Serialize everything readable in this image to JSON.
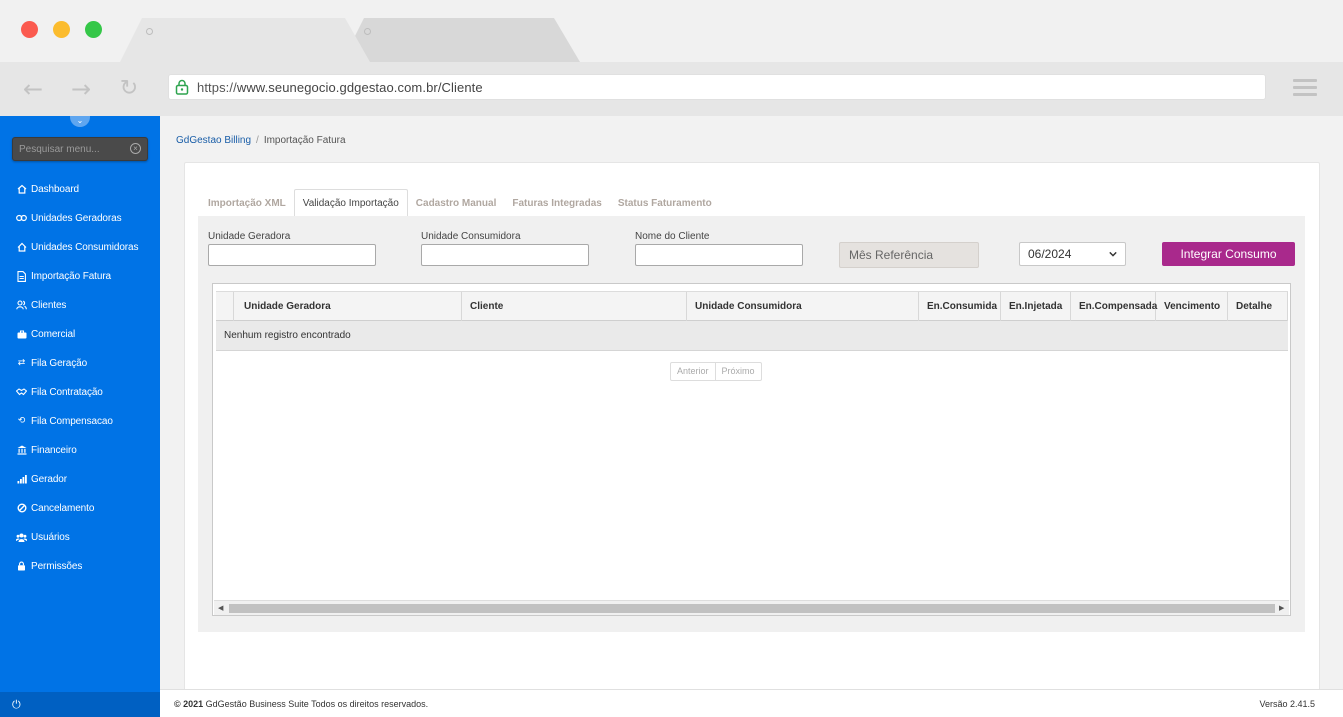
{
  "browser": {
    "url_scheme": "https://",
    "url_host": "www.seunegocio.gdgestao.com.br/Cliente"
  },
  "sidebar": {
    "search_placeholder": "Pesquisar menu...",
    "items": [
      {
        "label": "Dashboard",
        "icon": "home-icon"
      },
      {
        "label": "Unidades Geradoras",
        "icon": "link-icon"
      },
      {
        "label": "Unidades Consumidoras",
        "icon": "house-icon"
      },
      {
        "label": "Importação Fatura",
        "icon": "file-icon"
      },
      {
        "label": "Clientes",
        "icon": "users-icon"
      },
      {
        "label": "Comercial",
        "icon": "briefcase-icon"
      },
      {
        "label": "Fila Geração",
        "icon": "exchange-icon"
      },
      {
        "label": "Fila Contratação",
        "icon": "handshake-icon"
      },
      {
        "label": "Fila Compensacao",
        "icon": "refresh-icon"
      },
      {
        "label": "Financeiro",
        "icon": "bank-icon"
      },
      {
        "label": "Gerador",
        "icon": "signal-icon"
      },
      {
        "label": "Cancelamento",
        "icon": "ban-icon"
      },
      {
        "label": "Usuários",
        "icon": "user-group-icon"
      },
      {
        "label": "Permissões",
        "icon": "lock-icon"
      }
    ]
  },
  "breadcrumb": {
    "home": "GdGestao Billing",
    "sep": "/",
    "current": "Importação Fatura"
  },
  "tabs": [
    {
      "label": "Importação XML",
      "active": false
    },
    {
      "label": "Validação Importação",
      "active": true
    },
    {
      "label": "Cadastro Manual",
      "active": false
    },
    {
      "label": "Faturas Integradas",
      "active": false
    },
    {
      "label": "Status Faturamento",
      "active": false
    }
  ],
  "filters": {
    "unidade_geradora_label": "Unidade Geradora",
    "unidade_geradora_value": "",
    "unidade_consumidora_label": "Unidade Consumidora",
    "unidade_consumidora_value": "",
    "nome_cliente_label": "Nome do Cliente",
    "nome_cliente_value": "",
    "mes_referencia": "Mês Referência",
    "mes_value": "06/2024",
    "integrar_label": "Integrar Consumo"
  },
  "grid": {
    "columns": [
      "",
      "Unidade Geradora",
      "Cliente",
      "Unidade Consumidora",
      "En.Consumida",
      "En.Injetada",
      "En.Compensada",
      "Vencimento",
      "Detalhe"
    ],
    "empty_text": "Nenhum registro encontrado",
    "pager_prev": "Anterior",
    "pager_next": "Próximo"
  },
  "footer": {
    "copyright_prefix": "© 2021",
    "copyright_text": "GdGestão Business Suite Todos os direitos reservados.",
    "version": "Versão 2.41.5"
  },
  "colors": {
    "sidebar": "#0073e6",
    "primary_button": "#a9298c"
  }
}
